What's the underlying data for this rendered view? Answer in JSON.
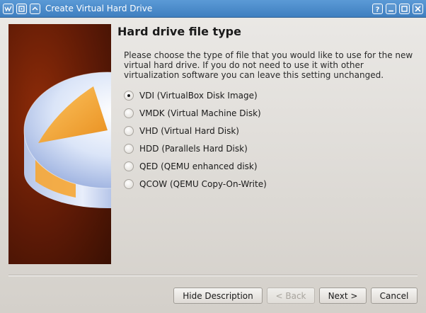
{
  "window": {
    "title": "Create Virtual Hard Drive",
    "left_icons": [
      "app-icon",
      "pin-icon",
      "shade-icon"
    ],
    "right_icons": [
      "help-icon",
      "minimize-icon",
      "maximize-icon",
      "close-icon"
    ]
  },
  "page": {
    "heading": "Hard drive file type",
    "description": "Please choose the type of file that you would like to use for the new virtual hard drive. If you do not need to use it with other virtualization software you can leave this setting unchanged."
  },
  "options": [
    {
      "label": "VDI (VirtualBox Disk Image)",
      "selected": true
    },
    {
      "label": "VMDK (Virtual Machine Disk)",
      "selected": false
    },
    {
      "label": "VHD (Virtual Hard Disk)",
      "selected": false
    },
    {
      "label": "HDD (Parallels Hard Disk)",
      "selected": false
    },
    {
      "label": "QED (QEMU enhanced disk)",
      "selected": false
    },
    {
      "label": "QCOW (QEMU Copy-On-Write)",
      "selected": false
    }
  ],
  "buttons": {
    "hide_description": "Hide Description",
    "back": "< Back",
    "next": "Next >",
    "cancel": "Cancel"
  },
  "colors": {
    "titlebar": "#4a8acb",
    "side_panel": "#5e1a06",
    "disk_accent": "#f4a228"
  }
}
